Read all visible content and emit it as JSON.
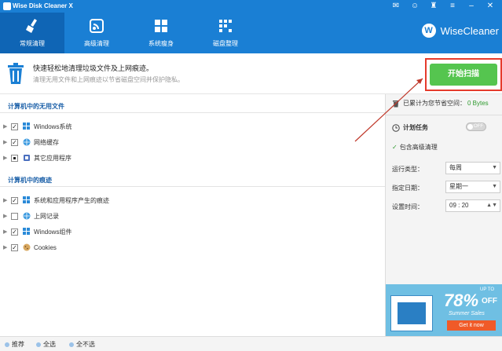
{
  "window": {
    "title": "Wise Disk Cleaner X",
    "controls": [
      "mail-icon",
      "user-icon",
      "skin-icon",
      "settings-icon",
      "minimize-icon",
      "close-icon"
    ]
  },
  "tabs": [
    {
      "label": "常规清理",
      "icon": "broom-icon",
      "active": true
    },
    {
      "label": "高级清理",
      "icon": "advanced-clean-icon",
      "active": false
    },
    {
      "label": "系统瘦身",
      "icon": "windows-icon",
      "active": false
    },
    {
      "label": "磁盘整理",
      "icon": "defrag-icon",
      "active": false
    }
  ],
  "brand": {
    "name": "WiseCleaner",
    "mark": "W"
  },
  "info": {
    "main": "快速轻松地清理垃圾文件及上网痕迹。",
    "sub": "清理无用文件和上网痕迹以节省磁盘空间并保护隐私。"
  },
  "scan_button": {
    "label": "开始扫描"
  },
  "sections": [
    {
      "title": "计算机中的无用文件",
      "items": [
        {
          "label": "Windows系统",
          "checked": "checked",
          "icon": "windows-icon"
        },
        {
          "label": "网络缓存",
          "checked": "checked",
          "icon": "globe-icon"
        },
        {
          "label": "其它应用程序",
          "checked": "partial",
          "icon": "app-icon"
        }
      ]
    },
    {
      "title": "计算机中的痕迹",
      "items": [
        {
          "label": "系统和应用程序产生的痕迹",
          "checked": "checked",
          "icon": "windows-icon"
        },
        {
          "label": "上网记录",
          "checked": "unchecked",
          "icon": "globe-icon"
        },
        {
          "label": "Windows组件",
          "checked": "checked",
          "icon": "windows-icon"
        },
        {
          "label": "Cookies",
          "checked": "checked",
          "icon": "cookie-icon"
        }
      ]
    }
  ],
  "right": {
    "saved_label": "已累计为您节省空间：",
    "saved_value": "0 Bytes",
    "schedule_label": "计划任务",
    "toggle_text": "OFF",
    "include_advanced": "包含高级清理",
    "run_type_label": "运行类型：",
    "run_type_value": "每周",
    "date_label": "指定日期：",
    "date_value": "星期一",
    "time_label": "设置时间：",
    "time_value": "09 : 20"
  },
  "ad": {
    "upto": "UP TO",
    "percent": "78%",
    "off": "OFF",
    "sale": "Summer Sales",
    "button": "Get it now"
  },
  "bottom": {
    "recommend": "推荐",
    "select_all": "全选",
    "select_none": "全不选"
  },
  "colors": {
    "header_blue": "#1a7fd4",
    "active_tab": "#0f65b5",
    "scan_green": "#55c54f",
    "highlight_red": "#e53b2c"
  }
}
